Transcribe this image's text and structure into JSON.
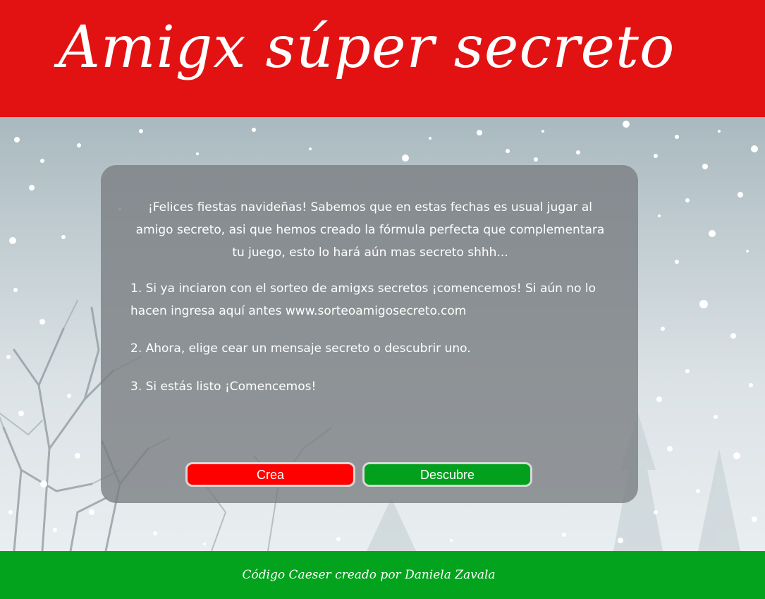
{
  "header": {
    "title": "Amigx súper secreto"
  },
  "colors": {
    "header_bg": "#e31212",
    "footer_bg": "#03a31d",
    "create_button": "#ff0000",
    "discover_button": "#03a01d",
    "text": "#ffffff"
  },
  "card": {
    "intro": "¡Felices fiestas navideñas! Sabemos que en estas fechas es usual jugar al amigo secreto, asi que hemos creado la fórmula perfecta que complementara tu juego, esto lo hará aún mas secreto shhh...",
    "steps": [
      "1. Si ya inciaron con el sorteo de amigxs secretos ¡comencemos! Si aún no lo hacen ingresa aquí antes www.sorteoamigosecreto.com",
      "2. Ahora, elige cear un mensaje secreto o descubrir uno.",
      "3. Si estás listo ¡Comencemos!"
    ],
    "buttons": {
      "create_label": "Crea",
      "discover_label": "Descubre"
    }
  },
  "footer": {
    "credit": "Código Caeser creado por Daniela Zavala"
  }
}
